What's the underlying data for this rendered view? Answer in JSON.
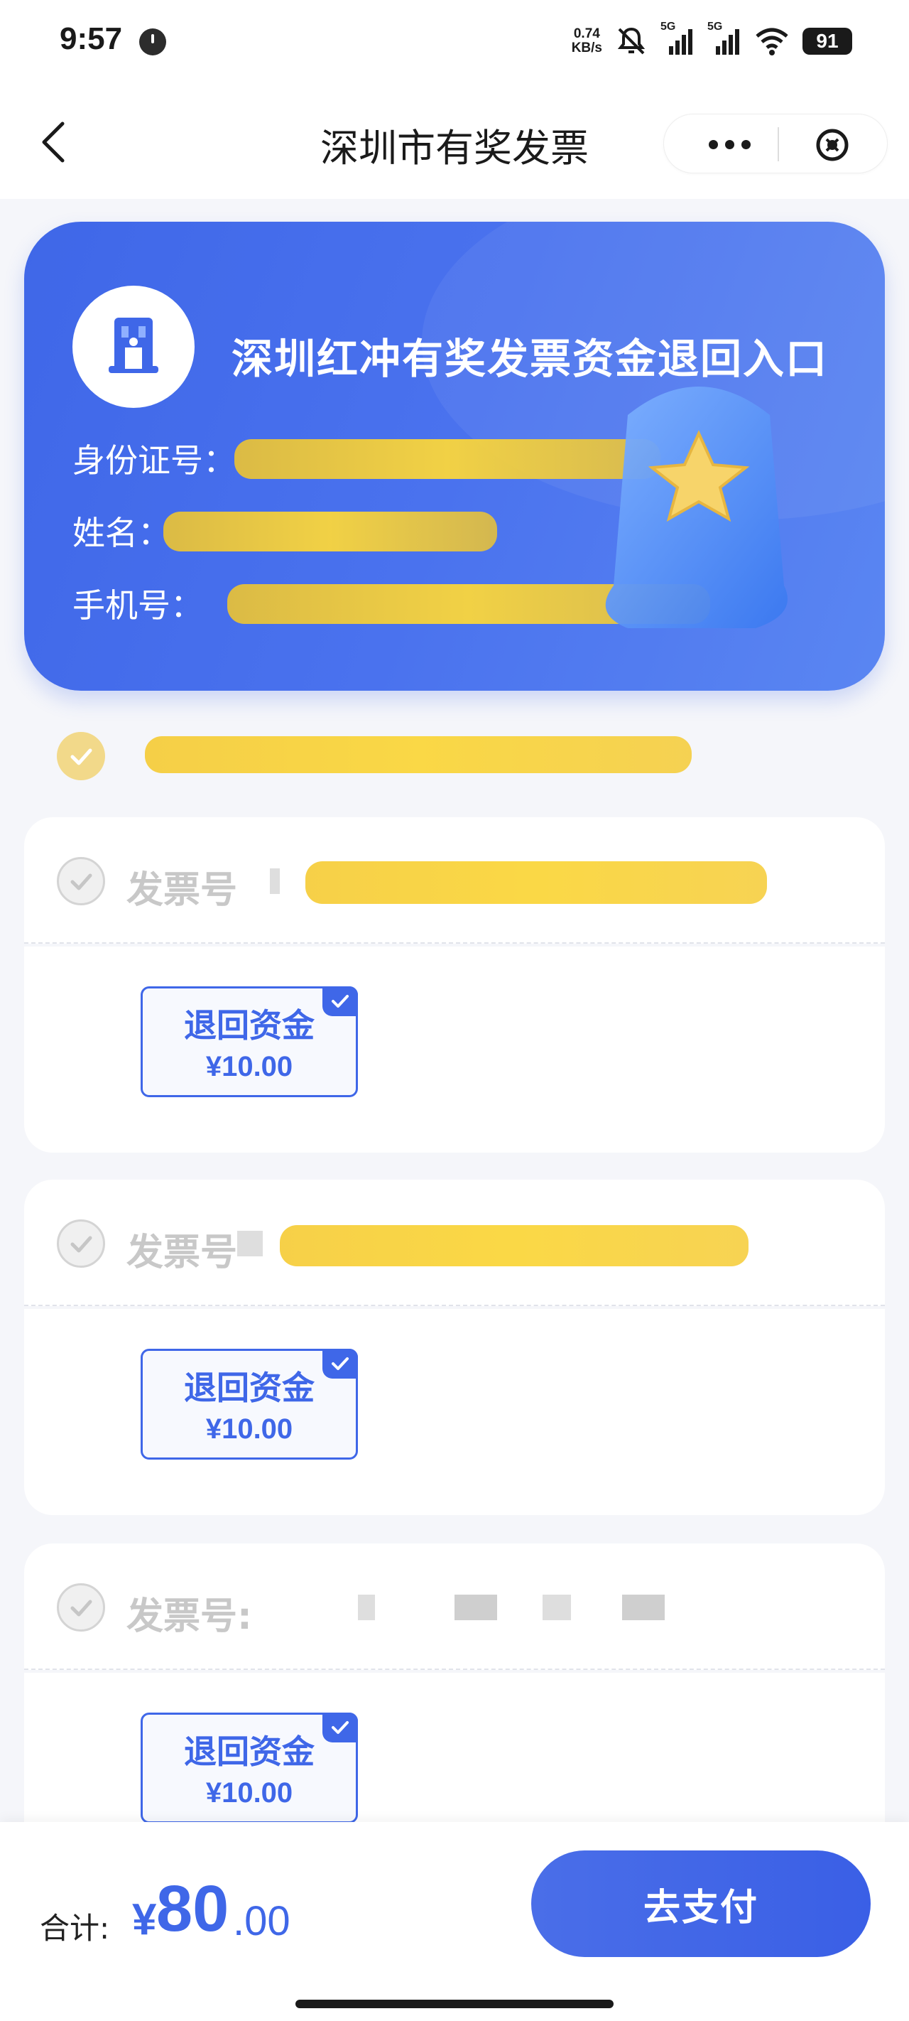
{
  "status_bar": {
    "time": "9:57",
    "net_speed_value": "0.74",
    "net_speed_unit": "KB/s",
    "signal_1_label": "5G",
    "signal_2_label": "5G",
    "battery": "91"
  },
  "nav": {
    "title": "深圳市有奖发票"
  },
  "hero": {
    "title": "深圳红冲有奖发票资金退回入口",
    "id_label": "身份证号：",
    "name_label": "姓名：",
    "phone_label": "手机号："
  },
  "invoices": [
    {
      "label": "发票号",
      "chip_title": "退回资金",
      "chip_amount": "¥10.00"
    },
    {
      "label": "发票号",
      "chip_title": "退回资金",
      "chip_amount": "¥10.00"
    },
    {
      "label": "发票号:",
      "chip_title": "退回资金",
      "chip_amount": "¥10.00"
    }
  ],
  "footer": {
    "total_label": "合计:",
    "total_currency": "¥",
    "total_integer": "80",
    "total_decimal": ".00",
    "pay_label": "去支付"
  },
  "colors": {
    "accent": "#3f67e8",
    "highlight_scribble": "#f5c828"
  },
  "icons": [
    "clock-icon",
    "mute-icon",
    "signal-icon",
    "wifi-icon",
    "back-icon",
    "more-icon",
    "close-icon",
    "building-logo-icon",
    "bell-star-icon",
    "check-icon"
  ]
}
